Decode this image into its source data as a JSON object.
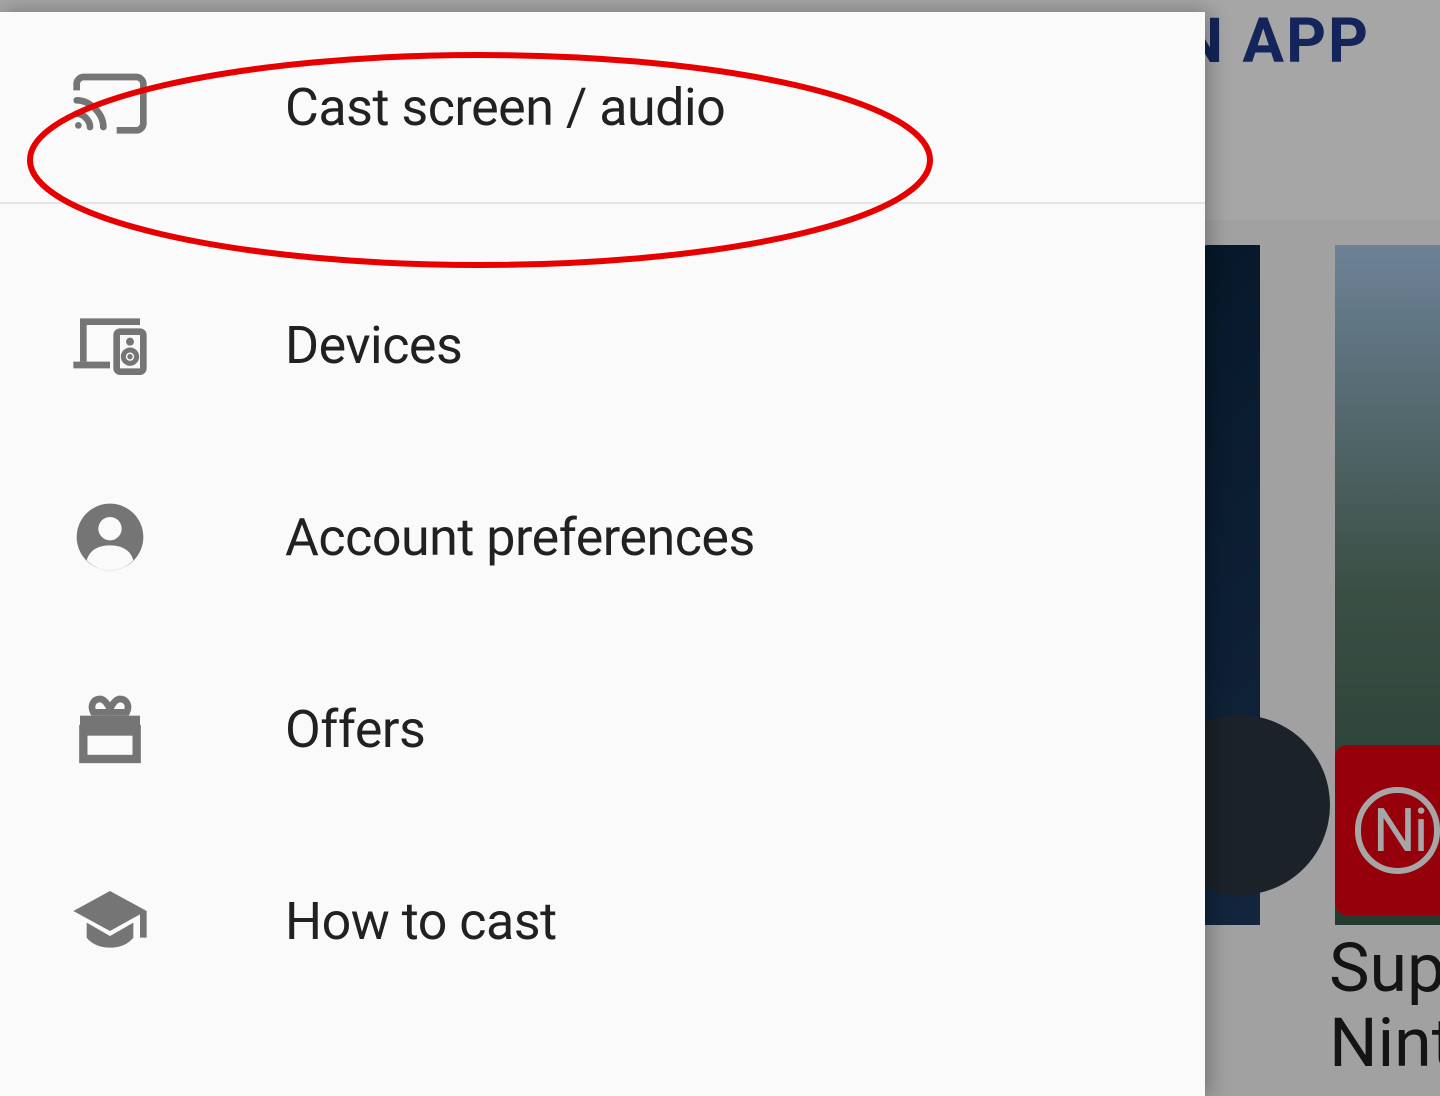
{
  "background": {
    "header_text_fragment": "EN APP",
    "nintendo_badge_text": "Ni",
    "bottom_text_line1": "Supe",
    "bottom_text_line2": "Ninte"
  },
  "drawer": {
    "header": {
      "label": "Cast screen / audio",
      "icon": "cast-icon"
    },
    "items": [
      {
        "label": "Devices",
        "icon": "devices-icon"
      },
      {
        "label": "Account preferences",
        "icon": "account-icon"
      },
      {
        "label": "Offers",
        "icon": "offers-icon"
      },
      {
        "label": "How to cast",
        "icon": "school-icon"
      }
    ]
  },
  "annotation": {
    "type": "ellipse-highlight",
    "color": "#e60000",
    "target": "cast-screen-audio"
  }
}
